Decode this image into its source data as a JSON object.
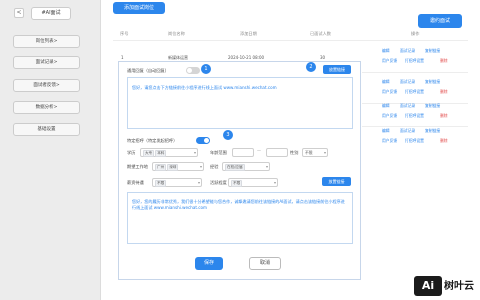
{
  "sidebar": {
    "back": "<",
    "title": "#AI面试",
    "items": [
      {
        "label": "岗位列表>"
      },
      {
        "label": "面试记录>"
      },
      {
        "label": "面试者反馈>"
      },
      {
        "label": "数据分析>"
      },
      {
        "label": "基础设置"
      }
    ]
  },
  "toolbar": {
    "add_label": "添加面试岗位",
    "invite_label": "邀约面试"
  },
  "table": {
    "headers": [
      "序号",
      "岗位名称",
      "添加日期",
      "已面试人数",
      "操作"
    ],
    "first_row": {
      "index": "1",
      "name": "新媒体运营",
      "date": "2024-10-21 08:00",
      "count": "30"
    },
    "actions": [
      {
        "links": [
          "编辑",
          "面试记录",
          "复制链接"
        ],
        "links2": [
          "用户反馈",
          "打招呼设置"
        ],
        "delete": "删除"
      },
      {
        "links": [
          "编辑",
          "面试记录",
          "复制链接"
        ],
        "links2": [
          "用户反馈",
          "打招呼设置"
        ],
        "delete": "删除"
      },
      {
        "links": [
          "编辑",
          "面试记录",
          "复制链接"
        ],
        "links2": [
          "用户反馈",
          "打招呼设置"
        ],
        "delete": "删除"
      },
      {
        "links": [
          "编辑",
          "面试记录",
          "复制链接"
        ],
        "links2": [
          "用户反馈",
          "打招呼设置"
        ],
        "delete": "删除"
      }
    ]
  },
  "modal": {
    "general_reply": {
      "label": "通用回复（自动回复）",
      "toggle_on": false,
      "badge": "1",
      "message": "您好，请您点击下方链接前往小程序进行线上面试 www.mianshi.wechat.com",
      "insert_link": "放置链接",
      "insert_badge": "2"
    },
    "specific_reply": {
      "label": "特定招呼（特定发起招呼）",
      "toggle_on": true,
      "badge": "3",
      "filters": {
        "education": {
          "label": "学历",
          "tags": [
            "大专",
            "本科"
          ]
        },
        "age": {
          "label": "年龄范围",
          "from": "",
          "to": ""
        },
        "gender": {
          "label": "性别",
          "value": "不限"
        },
        "location": {
          "label": "期望工作地",
          "tags": [
            "广州",
            "深圳"
          ]
        },
        "experience": {
          "label": "经验",
          "tags": [
            "在校/应届"
          ]
        },
        "salary": {
          "label": "薪资待遇",
          "value": "不限"
        },
        "activity": {
          "label": "活跃程度",
          "value": "不限"
        }
      },
      "insert_link": "放置链接",
      "message": "您好，您的履历非常优秀，我们很十分希望能与您合作，诚挚邀请您前往该链接的AI面试，请点击该链接前往小程序进行线上面试 www.mianshi.wechat.com"
    },
    "save_label": "保存",
    "cancel_label": "取消"
  },
  "watermark": {
    "logo": "Ai",
    "text": "树叶云"
  },
  "colors": {
    "accent": "#2c86ec",
    "danger": "#e24a4a",
    "sidebar_bg": "#ececec"
  }
}
